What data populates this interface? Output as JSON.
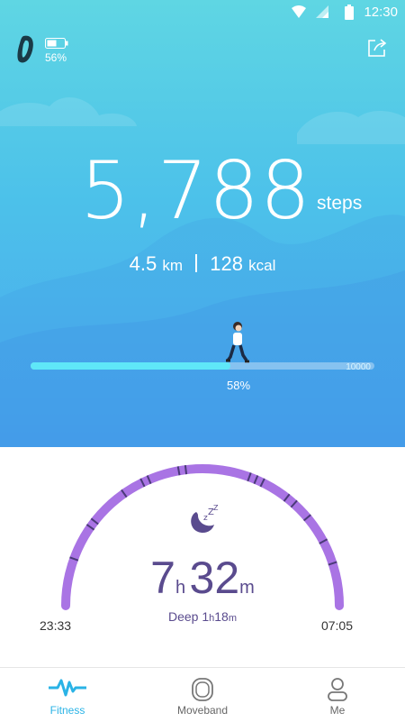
{
  "status": {
    "time": "12:30"
  },
  "device": {
    "battery": "56%"
  },
  "steps": {
    "value": "5,788",
    "unit": "steps",
    "distance": "4.5",
    "distance_unit": "km",
    "calories": "128",
    "calories_unit": "kcal",
    "goal": "10000",
    "progress_label": "58%",
    "progress_fraction": 0.58
  },
  "sleep": {
    "hours": "7",
    "hours_unit": "h",
    "minutes": "32",
    "minutes_unit": "m",
    "deep_label": "Deep",
    "deep_hours": "1",
    "deep_hours_unit": "h",
    "deep_minutes": "18",
    "deep_minutes_unit": "m",
    "start": "23:33",
    "end": "07:05"
  },
  "nav": {
    "items": [
      {
        "label": "Fitness",
        "icon": "pulse-icon",
        "active": true
      },
      {
        "label": "Moveband",
        "icon": "band-icon",
        "active": false
      },
      {
        "label": "Me",
        "icon": "person-icon",
        "active": false
      }
    ]
  },
  "colors": {
    "accent": "#2ab3e6",
    "sleep_arc": "#a974e4",
    "sleep_text": "#5a4b8e",
    "progress": "#5fe7f8"
  }
}
